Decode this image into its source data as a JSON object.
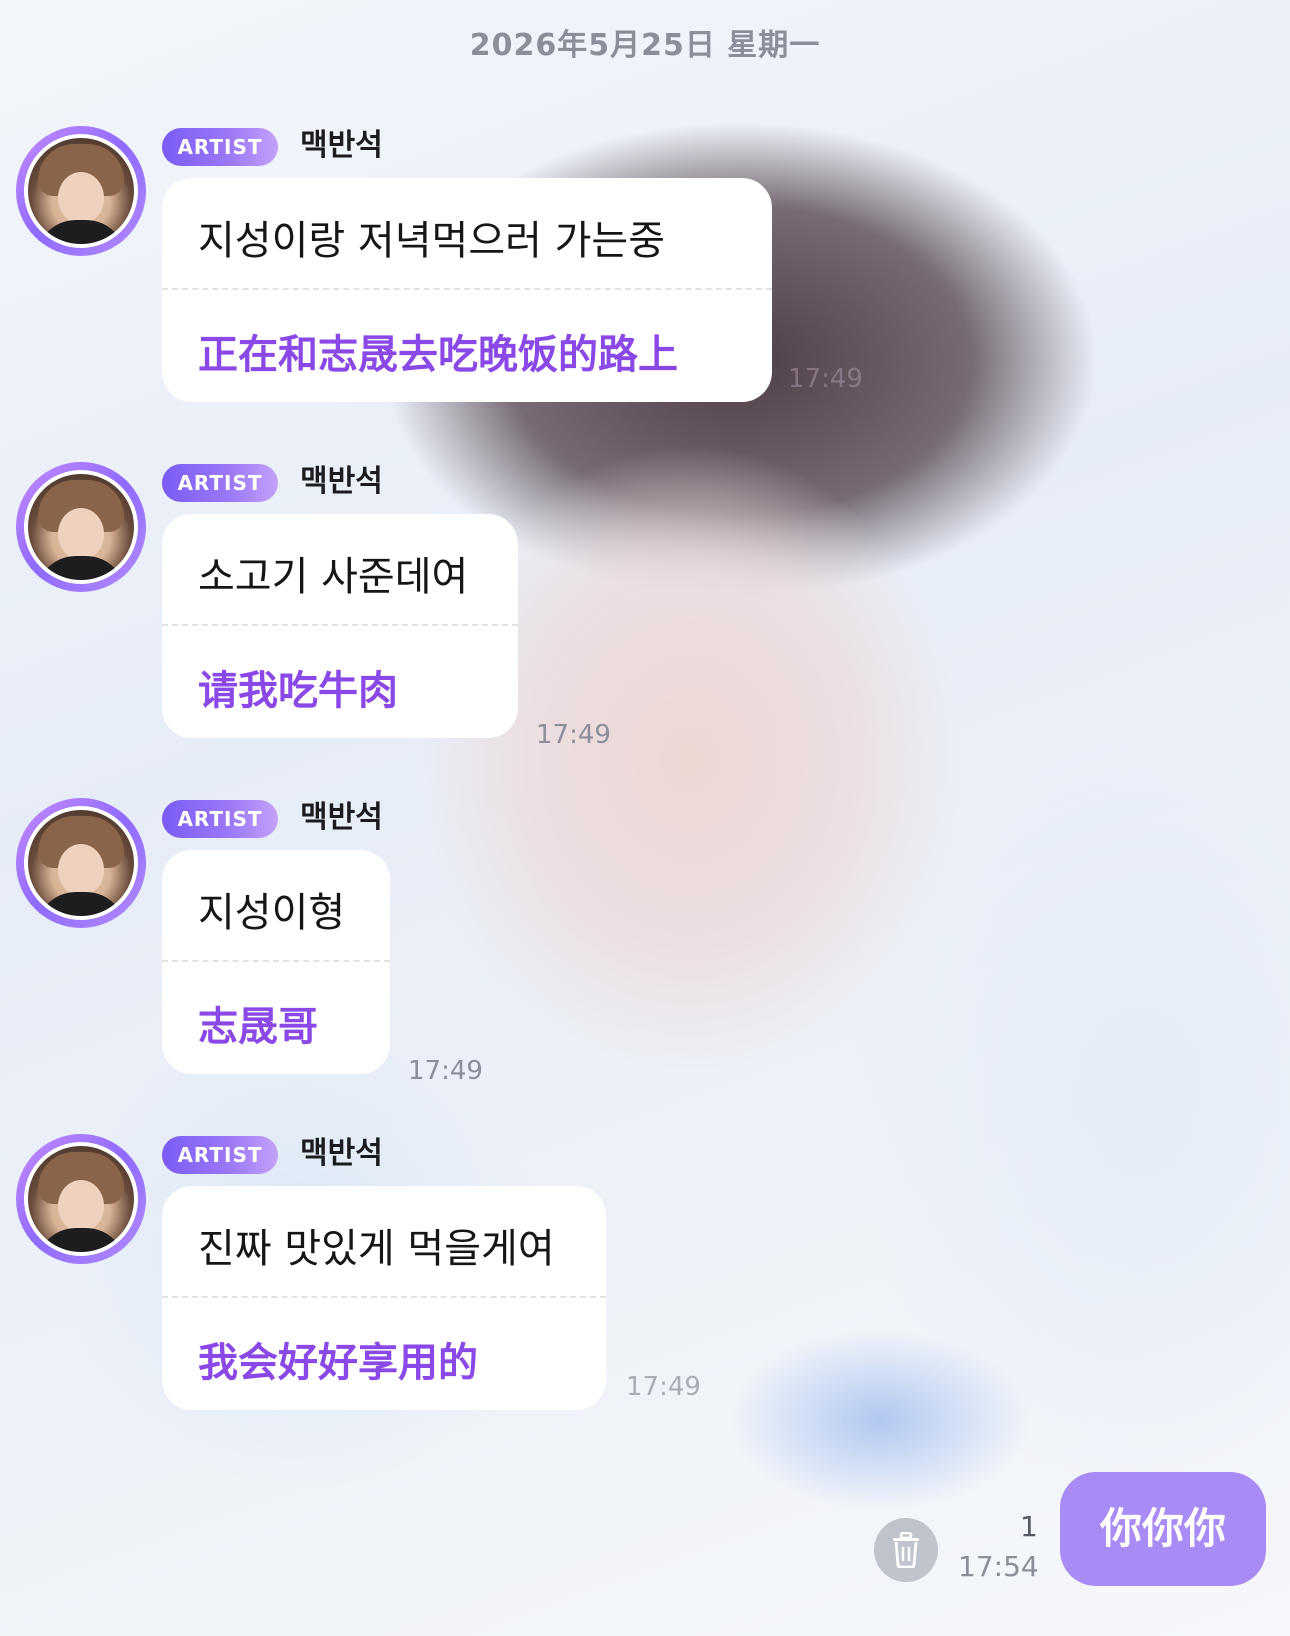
{
  "date_header": "2026年5月25日 星期一",
  "colors": {
    "accent_purple": "#8a49e6",
    "badge_gradient_start": "#7a5cf5",
    "my_bubble": "#a88bf5"
  },
  "messages": [
    {
      "badge": "ARTIST",
      "sender": "맥반석",
      "korean": "지성이랑 저녁먹으러 가는중",
      "translation": "正在和志晟去吃晚饭的路上",
      "time": "17:49"
    },
    {
      "badge": "ARTIST",
      "sender": "맥반석",
      "korean": "소고기 사준데여",
      "translation": "请我吃牛肉",
      "time": "17:49"
    },
    {
      "badge": "ARTIST",
      "sender": "맥반석",
      "korean": "지성이형",
      "translation": "志晟哥",
      "time": "17:49"
    },
    {
      "badge": "ARTIST",
      "sender": "맥반석",
      "korean": "진짜 맛있게 먹을게여",
      "translation": "我会好好享用的",
      "time": "17:49"
    }
  ],
  "my_message": {
    "text": "你你你",
    "unread_count": "1",
    "time": "17:54",
    "delete_icon": "trash-icon"
  }
}
